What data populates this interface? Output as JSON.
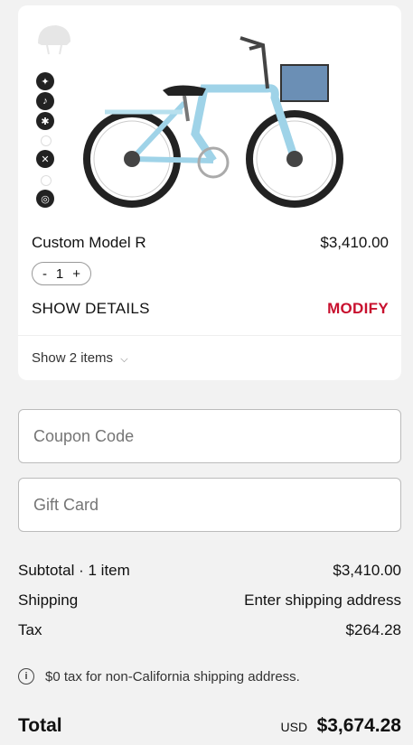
{
  "cart_item": {
    "name": "Custom Model R",
    "price": "$3,410.00",
    "quantity": "1",
    "qty_minus": "-",
    "qty_plus": "+",
    "show_details": "SHOW DETAILS",
    "modify": "MODIFY",
    "show_items": "Show 2 items",
    "option_icons": [
      "light-icon",
      "bell-icon",
      "kickstand-icon",
      "lock-icon",
      "cross-icon",
      "shield-icon",
      "disc-icon"
    ]
  },
  "coupon": {
    "placeholder": "Coupon Code"
  },
  "gift_card": {
    "placeholder": "Gift Card"
  },
  "summary": {
    "subtotal_label": "Subtotal · 1 item",
    "subtotal_value": "$3,410.00",
    "shipping_label": "Shipping",
    "shipping_value": "Enter shipping address",
    "tax_label": "Tax",
    "tax_value": "$264.28",
    "tax_note": "$0 tax for non-California shipping address.",
    "total_label": "Total",
    "total_currency": "USD",
    "total_value": "$3,674.28"
  },
  "colors": {
    "accent": "#c8102e",
    "bike": "#9fd3e8",
    "basket": "#6b8fb5"
  }
}
